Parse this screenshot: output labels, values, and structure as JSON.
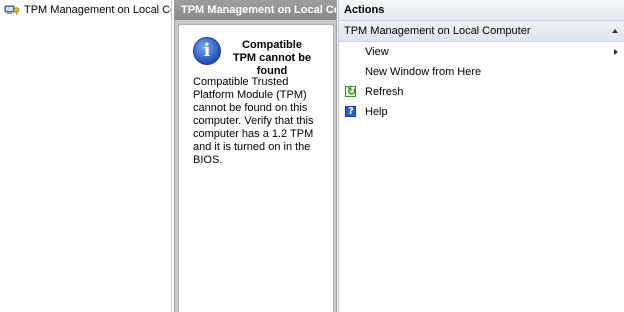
{
  "tree": {
    "root_label": "TPM Management on Local Comp",
    "root_icon": "tpm-computer-icon"
  },
  "middle": {
    "header": "TPM Management on Local Comp...",
    "message_title": "Compatible TPM cannot be found",
    "message_body": "Compatible Trusted Platform Module (TPM) cannot be found on this computer. Verify that this computer has a 1.2 TPM and it is turned on in the BIOS.",
    "icon": "info-icon"
  },
  "actions": {
    "header": "Actions",
    "section_label": "TPM Management on Local Computer",
    "items": [
      {
        "label": "View",
        "icon": "",
        "submenu": true
      },
      {
        "label": "New Window from Here",
        "icon": "",
        "submenu": false
      },
      {
        "label": "Refresh",
        "icon": "refresh-icon",
        "submenu": false
      },
      {
        "label": "Help",
        "icon": "help-icon",
        "submenu": false
      }
    ]
  }
}
